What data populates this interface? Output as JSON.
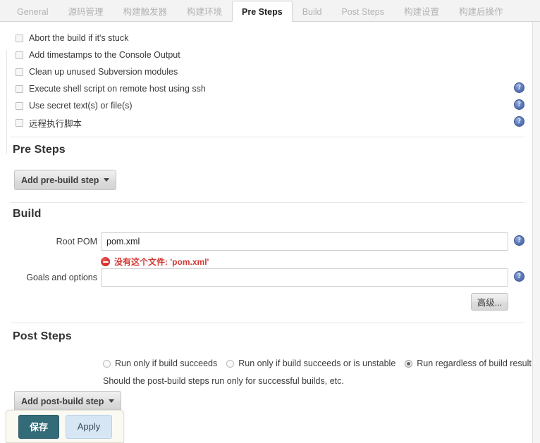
{
  "tabs": [
    {
      "label": "General",
      "active": false
    },
    {
      "label": "源码管理",
      "active": false
    },
    {
      "label": "构建触发器",
      "active": false
    },
    {
      "label": "构建环境",
      "active": false
    },
    {
      "label": "Pre Steps",
      "active": true
    },
    {
      "label": "Build",
      "active": false
    },
    {
      "label": "Post Steps",
      "active": false
    },
    {
      "label": "构建设置",
      "active": false
    },
    {
      "label": "构建后操作",
      "active": false
    }
  ],
  "build_environment": {
    "checkboxes": [
      {
        "label": "Abort the build if it's stuck",
        "checked": false,
        "help": false
      },
      {
        "label": "Add timestamps to the Console Output",
        "checked": false,
        "help": false
      },
      {
        "label": "Clean up unused Subversion modules",
        "checked": false,
        "help": false
      },
      {
        "label": "Execute shell script on remote host using ssh",
        "checked": false,
        "help": true
      },
      {
        "label": "Use secret text(s) or file(s)",
        "checked": false,
        "help": true
      },
      {
        "label": "远程执行脚本",
        "checked": false,
        "help": true
      }
    ]
  },
  "pre_steps": {
    "heading": "Pre Steps",
    "add_button": "Add pre-build step"
  },
  "build": {
    "heading": "Build",
    "root_pom": {
      "label": "Root POM",
      "value": "pom.xml",
      "placeholder": "",
      "error": "没有这个文件: 'pom.xml'"
    },
    "goals": {
      "label": "Goals and options",
      "value": "",
      "placeholder": ""
    },
    "advanced_button": "高级..."
  },
  "post_steps": {
    "heading": "Post Steps",
    "radios": [
      {
        "label": "Run only if build succeeds",
        "selected": false
      },
      {
        "label": "Run only if build succeeds or is unstable",
        "selected": false
      },
      {
        "label": "Run regardless of build result",
        "selected": true
      }
    ],
    "hint": "Should the post-build steps run only for successful builds, etc.",
    "add_button": "Add post-build step"
  },
  "save_bar": {
    "save_label": "保存",
    "apply_label": "Apply"
  },
  "icons": {
    "help": "?"
  },
  "colors": {
    "accent_save": "#336b78",
    "accent_apply": "#d6e6f4",
    "error_red": "#d33833",
    "help_blue": "#5b78b8"
  }
}
